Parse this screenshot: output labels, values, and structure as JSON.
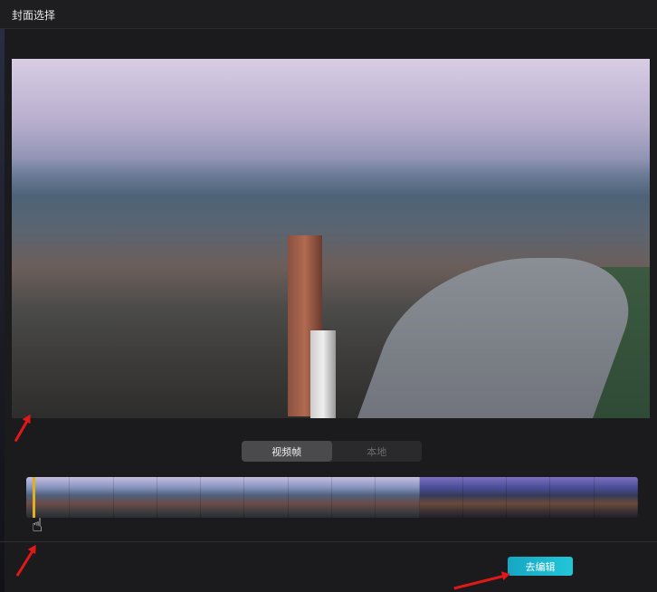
{
  "dialog": {
    "title": "封面选择"
  },
  "tabs": [
    {
      "label": "视频帧",
      "active": true
    },
    {
      "label": "本地",
      "active": false
    }
  ],
  "filmstrip": {
    "frame_count": 14,
    "playhead_position_fraction": 0.01
  },
  "actions": {
    "edit_label": "去编辑"
  },
  "colors": {
    "accent": "#1fb8d0",
    "playhead": "#e0b020",
    "annotation": "#e01818"
  }
}
